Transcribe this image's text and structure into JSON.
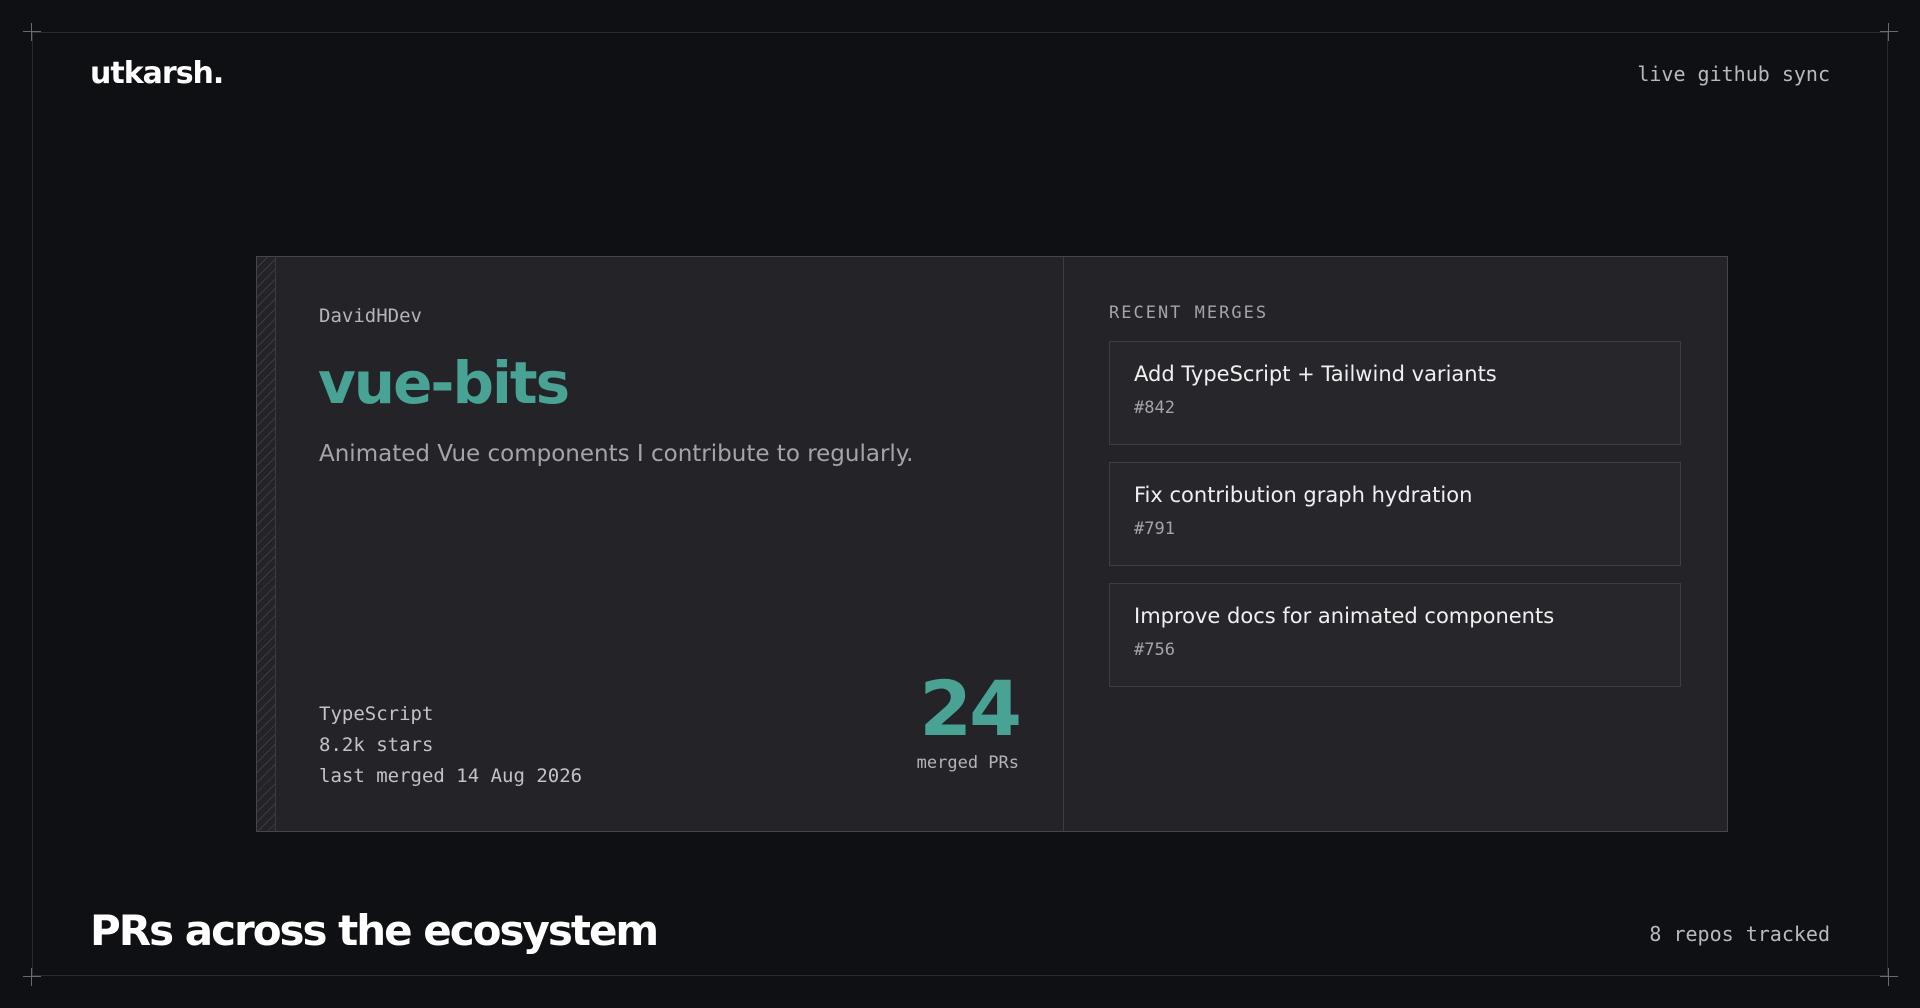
{
  "header": {
    "brand": "utkarsh.",
    "status": "live github sync"
  },
  "repo_card": {
    "owner": "DavidHDev",
    "name": "vue-bits",
    "description": "Animated Vue components I contribute to regularly.",
    "language": "TypeScript",
    "stars": "8.2k stars",
    "last_merged": "last merged 14 Aug 2026",
    "merged_count": "24",
    "merged_label": "merged PRs"
  },
  "recent_merges": {
    "label": "RECENT MERGES",
    "items": [
      {
        "title": "Add TypeScript + Tailwind variants",
        "number": "#842"
      },
      {
        "title": "Fix contribution graph hydration",
        "number": "#791"
      },
      {
        "title": "Improve docs for animated components",
        "number": "#756"
      }
    ]
  },
  "footer": {
    "title": "PRs across the ecosystem",
    "count": "8 repos tracked"
  },
  "colors": {
    "background": "#0f1013",
    "card": "#232328",
    "accent": "#49a394"
  }
}
